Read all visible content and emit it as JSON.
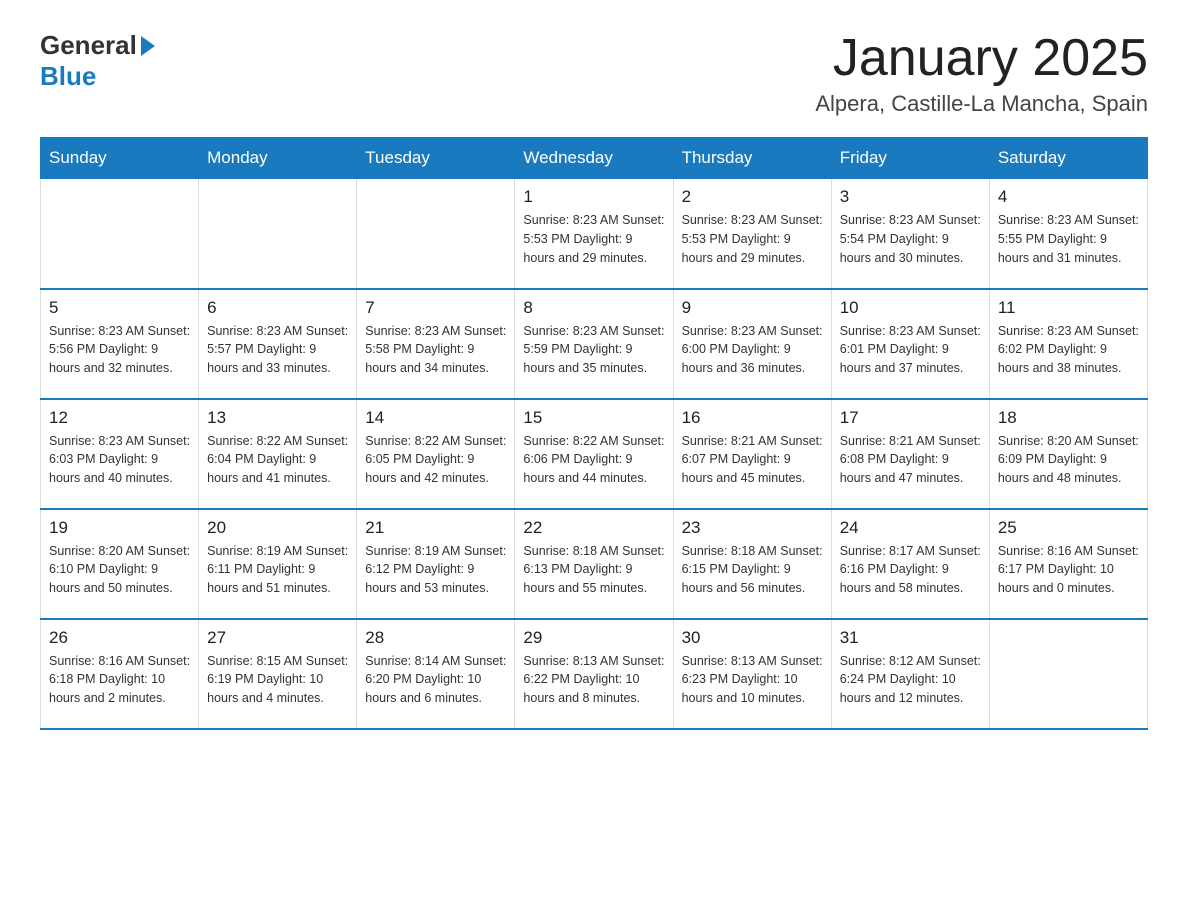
{
  "header": {
    "logo_general": "General",
    "logo_blue": "Blue",
    "month_title": "January 2025",
    "location": "Alpera, Castille-La Mancha, Spain"
  },
  "days_of_week": [
    "Sunday",
    "Monday",
    "Tuesday",
    "Wednesday",
    "Thursday",
    "Friday",
    "Saturday"
  ],
  "weeks": [
    [
      {
        "day": "",
        "info": ""
      },
      {
        "day": "",
        "info": ""
      },
      {
        "day": "",
        "info": ""
      },
      {
        "day": "1",
        "info": "Sunrise: 8:23 AM\nSunset: 5:53 PM\nDaylight: 9 hours\nand 29 minutes."
      },
      {
        "day": "2",
        "info": "Sunrise: 8:23 AM\nSunset: 5:53 PM\nDaylight: 9 hours\nand 29 minutes."
      },
      {
        "day": "3",
        "info": "Sunrise: 8:23 AM\nSunset: 5:54 PM\nDaylight: 9 hours\nand 30 minutes."
      },
      {
        "day": "4",
        "info": "Sunrise: 8:23 AM\nSunset: 5:55 PM\nDaylight: 9 hours\nand 31 minutes."
      }
    ],
    [
      {
        "day": "5",
        "info": "Sunrise: 8:23 AM\nSunset: 5:56 PM\nDaylight: 9 hours\nand 32 minutes."
      },
      {
        "day": "6",
        "info": "Sunrise: 8:23 AM\nSunset: 5:57 PM\nDaylight: 9 hours\nand 33 minutes."
      },
      {
        "day": "7",
        "info": "Sunrise: 8:23 AM\nSunset: 5:58 PM\nDaylight: 9 hours\nand 34 minutes."
      },
      {
        "day": "8",
        "info": "Sunrise: 8:23 AM\nSunset: 5:59 PM\nDaylight: 9 hours\nand 35 minutes."
      },
      {
        "day": "9",
        "info": "Sunrise: 8:23 AM\nSunset: 6:00 PM\nDaylight: 9 hours\nand 36 minutes."
      },
      {
        "day": "10",
        "info": "Sunrise: 8:23 AM\nSunset: 6:01 PM\nDaylight: 9 hours\nand 37 minutes."
      },
      {
        "day": "11",
        "info": "Sunrise: 8:23 AM\nSunset: 6:02 PM\nDaylight: 9 hours\nand 38 minutes."
      }
    ],
    [
      {
        "day": "12",
        "info": "Sunrise: 8:23 AM\nSunset: 6:03 PM\nDaylight: 9 hours\nand 40 minutes."
      },
      {
        "day": "13",
        "info": "Sunrise: 8:22 AM\nSunset: 6:04 PM\nDaylight: 9 hours\nand 41 minutes."
      },
      {
        "day": "14",
        "info": "Sunrise: 8:22 AM\nSunset: 6:05 PM\nDaylight: 9 hours\nand 42 minutes."
      },
      {
        "day": "15",
        "info": "Sunrise: 8:22 AM\nSunset: 6:06 PM\nDaylight: 9 hours\nand 44 minutes."
      },
      {
        "day": "16",
        "info": "Sunrise: 8:21 AM\nSunset: 6:07 PM\nDaylight: 9 hours\nand 45 minutes."
      },
      {
        "day": "17",
        "info": "Sunrise: 8:21 AM\nSunset: 6:08 PM\nDaylight: 9 hours\nand 47 minutes."
      },
      {
        "day": "18",
        "info": "Sunrise: 8:20 AM\nSunset: 6:09 PM\nDaylight: 9 hours\nand 48 minutes."
      }
    ],
    [
      {
        "day": "19",
        "info": "Sunrise: 8:20 AM\nSunset: 6:10 PM\nDaylight: 9 hours\nand 50 minutes."
      },
      {
        "day": "20",
        "info": "Sunrise: 8:19 AM\nSunset: 6:11 PM\nDaylight: 9 hours\nand 51 minutes."
      },
      {
        "day": "21",
        "info": "Sunrise: 8:19 AM\nSunset: 6:12 PM\nDaylight: 9 hours\nand 53 minutes."
      },
      {
        "day": "22",
        "info": "Sunrise: 8:18 AM\nSunset: 6:13 PM\nDaylight: 9 hours\nand 55 minutes."
      },
      {
        "day": "23",
        "info": "Sunrise: 8:18 AM\nSunset: 6:15 PM\nDaylight: 9 hours\nand 56 minutes."
      },
      {
        "day": "24",
        "info": "Sunrise: 8:17 AM\nSunset: 6:16 PM\nDaylight: 9 hours\nand 58 minutes."
      },
      {
        "day": "25",
        "info": "Sunrise: 8:16 AM\nSunset: 6:17 PM\nDaylight: 10 hours\nand 0 minutes."
      }
    ],
    [
      {
        "day": "26",
        "info": "Sunrise: 8:16 AM\nSunset: 6:18 PM\nDaylight: 10 hours\nand 2 minutes."
      },
      {
        "day": "27",
        "info": "Sunrise: 8:15 AM\nSunset: 6:19 PM\nDaylight: 10 hours\nand 4 minutes."
      },
      {
        "day": "28",
        "info": "Sunrise: 8:14 AM\nSunset: 6:20 PM\nDaylight: 10 hours\nand 6 minutes."
      },
      {
        "day": "29",
        "info": "Sunrise: 8:13 AM\nSunset: 6:22 PM\nDaylight: 10 hours\nand 8 minutes."
      },
      {
        "day": "30",
        "info": "Sunrise: 8:13 AM\nSunset: 6:23 PM\nDaylight: 10 hours\nand 10 minutes."
      },
      {
        "day": "31",
        "info": "Sunrise: 8:12 AM\nSunset: 6:24 PM\nDaylight: 10 hours\nand 12 minutes."
      },
      {
        "day": "",
        "info": ""
      }
    ]
  ]
}
